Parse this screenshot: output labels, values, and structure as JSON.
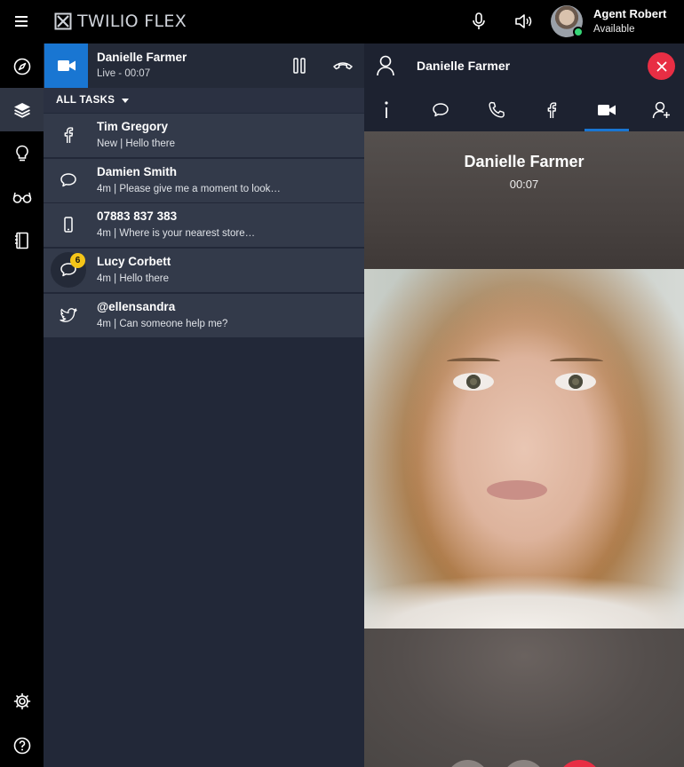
{
  "app": {
    "brand": "TWILIO FLEX"
  },
  "agent": {
    "name": "Agent Robert",
    "status": "Available",
    "status_color": "#36d576"
  },
  "sidenav": {
    "items": [
      {
        "icon": "compass-icon"
      },
      {
        "icon": "layers-icon",
        "active": true
      },
      {
        "icon": "lightbulb-icon"
      },
      {
        "icon": "glasses-icon"
      },
      {
        "icon": "notebook-icon"
      },
      {
        "icon": "gear-icon"
      },
      {
        "icon": "help-icon"
      }
    ]
  },
  "active_task": {
    "name": "Danielle Farmer",
    "status": "Live - 00:07",
    "channel": "video-icon",
    "accent": "#1976d2"
  },
  "task_filter": {
    "label": "ALL TASKS"
  },
  "tasks": [
    {
      "name": "Tim Gregory",
      "sub": "New | Hello there",
      "channel": "facebook-icon"
    },
    {
      "name": "Damien Smith",
      "sub": "4m | Please give me a moment to look…",
      "channel": "chat-icon"
    },
    {
      "name": "07883 837 383",
      "sub": "4m | Where is your nearest store…",
      "channel": "mobile-icon"
    },
    {
      "name": "Lucy Corbett",
      "sub": "4m | Hello there",
      "channel": "chat-icon",
      "badge": "6"
    },
    {
      "name": "@ellensandra",
      "sub": "4m | Can someone help me?",
      "channel": "twitter-icon"
    }
  ],
  "panel": {
    "contact_name": "Danielle Farmer",
    "tabs": [
      "info-icon",
      "chat-icon",
      "phone-icon",
      "facebook-icon",
      "video-icon",
      "add-contact-icon"
    ],
    "active_tab": "video-icon"
  },
  "video": {
    "caller_name": "Danielle Farmer",
    "timer": "00:07"
  },
  "colors": {
    "hangup": "#e82e44",
    "badge": "#f5c518"
  }
}
